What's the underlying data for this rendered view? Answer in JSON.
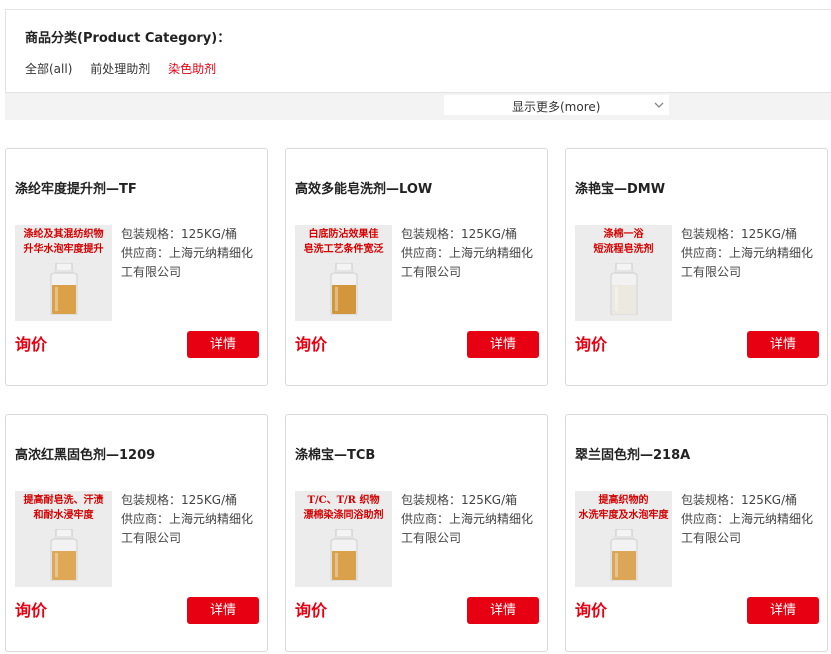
{
  "filter": {
    "title": "商品分类(Product Category)：",
    "options": [
      {
        "label": "全部(all)",
        "active": false
      },
      {
        "label": "前处理助剂",
        "active": false
      },
      {
        "label": "染色助剂",
        "active": true
      }
    ],
    "more_label": "显示更多(more)"
  },
  "colors": {
    "accent": "#e60012",
    "border": "#d9d9d9",
    "bar_bg": "#f3f3f3"
  },
  "price_label": "询价",
  "detail_label": "详情",
  "products": [
    {
      "name": "涤纶牢度提升剂—TF",
      "thumb_text": [
        "涤纶及其混纺织物",
        "升华水泡牢度提升"
      ],
      "liquid": "#d99a3a",
      "packaging": "包装规格：125KG/桶",
      "supplier": "供应商：上海元纳精细化工有限公司"
    },
    {
      "name": "高效多能皂洗剂—LOW",
      "thumb_text": [
        "白底防沾效果佳",
        "皂洗工艺条件宽泛"
      ],
      "liquid": "#cf8f2e",
      "packaging": "包装规格：125KG/桶",
      "supplier": "供应商：上海元纳精细化工有限公司"
    },
    {
      "name": "涤艳宝—DMW",
      "thumb_text": [
        "涤棉一浴",
        "短流程皂洗剂"
      ],
      "liquid": "#ece8de",
      "packaging": "包装规格：125KG/桶",
      "supplier": "供应商：上海元纳精细化工有限公司"
    },
    {
      "name": "高浓红黑固色剂—1209",
      "thumb_text": [
        "提高耐皂洗、汗渍",
        "和耐水浸牢度"
      ],
      "liquid": "#dca24a",
      "packaging": "包装规格：125KG/桶",
      "supplier": "供应商：上海元纳精细化工有限公司"
    },
    {
      "name": "涤棉宝—TCB",
      "thumb_text": [
        "T/C、T/R 织物",
        "漂棉染涤同浴助剂"
      ],
      "liquid": "#d69a3c",
      "packaging": "包装规格：125KG/箱",
      "supplier": "供应商：上海元纳精细化工有限公司"
    },
    {
      "name": "翠兰固色剂—218A",
      "thumb_text": [
        "提高织物的",
        "水洗牢度及水泡牢度"
      ],
      "liquid": "#d9a048",
      "packaging": "包装规格：125KG/桶",
      "supplier": "供应商：上海元纳精细化工有限公司"
    }
  ]
}
